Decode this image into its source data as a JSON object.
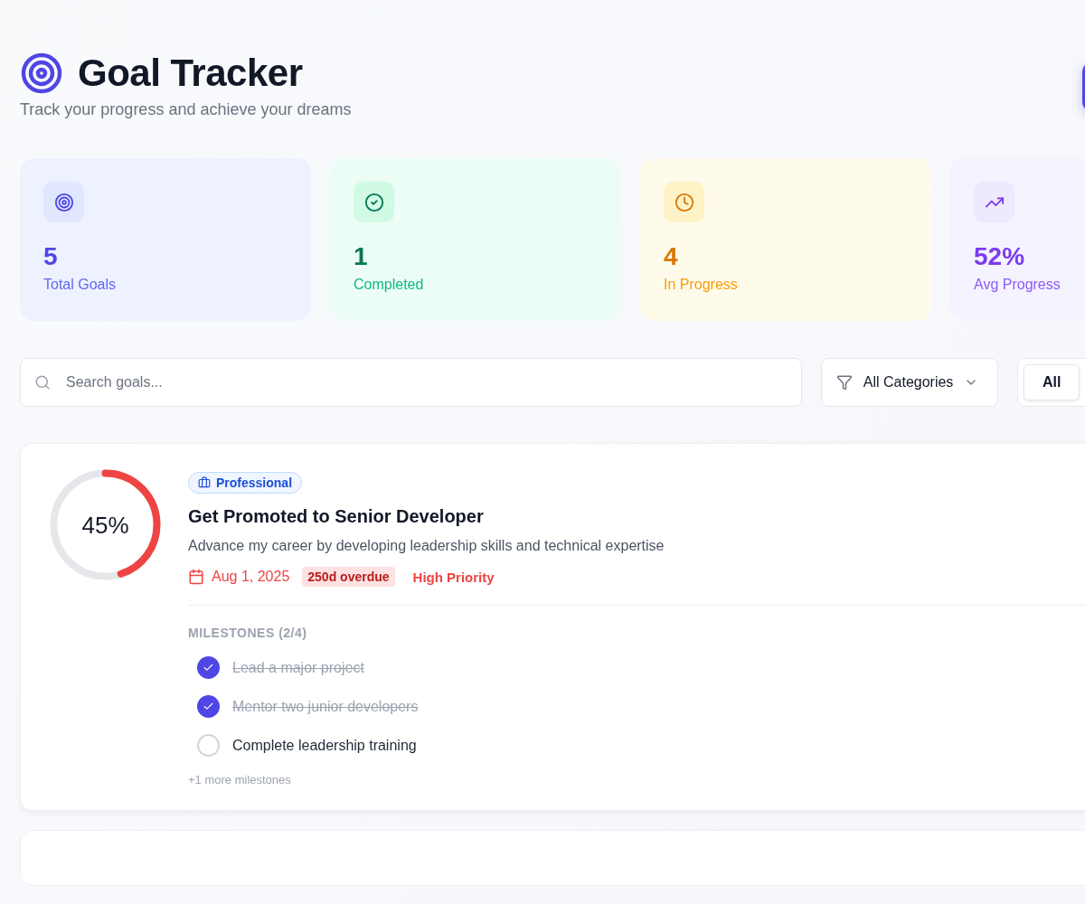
{
  "header": {
    "title": "Goal Tracker",
    "subtitle": "Track your progress and achieve your dreams"
  },
  "stats": [
    {
      "kind": "total",
      "value": "5",
      "label": "Total Goals"
    },
    {
      "kind": "completed",
      "value": "1",
      "label": "Completed"
    },
    {
      "kind": "progress",
      "value": "4",
      "label": "In Progress"
    },
    {
      "kind": "average",
      "value": "52%",
      "label": "Avg Progress"
    }
  ],
  "filters": {
    "search_placeholder": "Search goals...",
    "category": "All Categories",
    "status_tabs": [
      {
        "label": "All",
        "selected": true
      }
    ]
  },
  "goals": [
    {
      "category": "Professional",
      "title": "Get Promoted to Senior Developer",
      "description": "Advance my career by developing leadership skills and technical expertise",
      "progress_label": "45%",
      "level": 0.45,
      "due": "Aug 1, 2025",
      "overdue": true,
      "overdue_badge": "250d overdue",
      "priority": "High Priority",
      "milestones_heading": "MILESTONES (2/4)",
      "milestones": [
        {
          "label": "Lead a major project",
          "checked": true
        },
        {
          "label": "Mentor two junior developers",
          "checked": true
        },
        {
          "label": "Complete leadership training",
          "checked": false
        }
      ],
      "more": "+1 more milestones"
    }
  ]
}
